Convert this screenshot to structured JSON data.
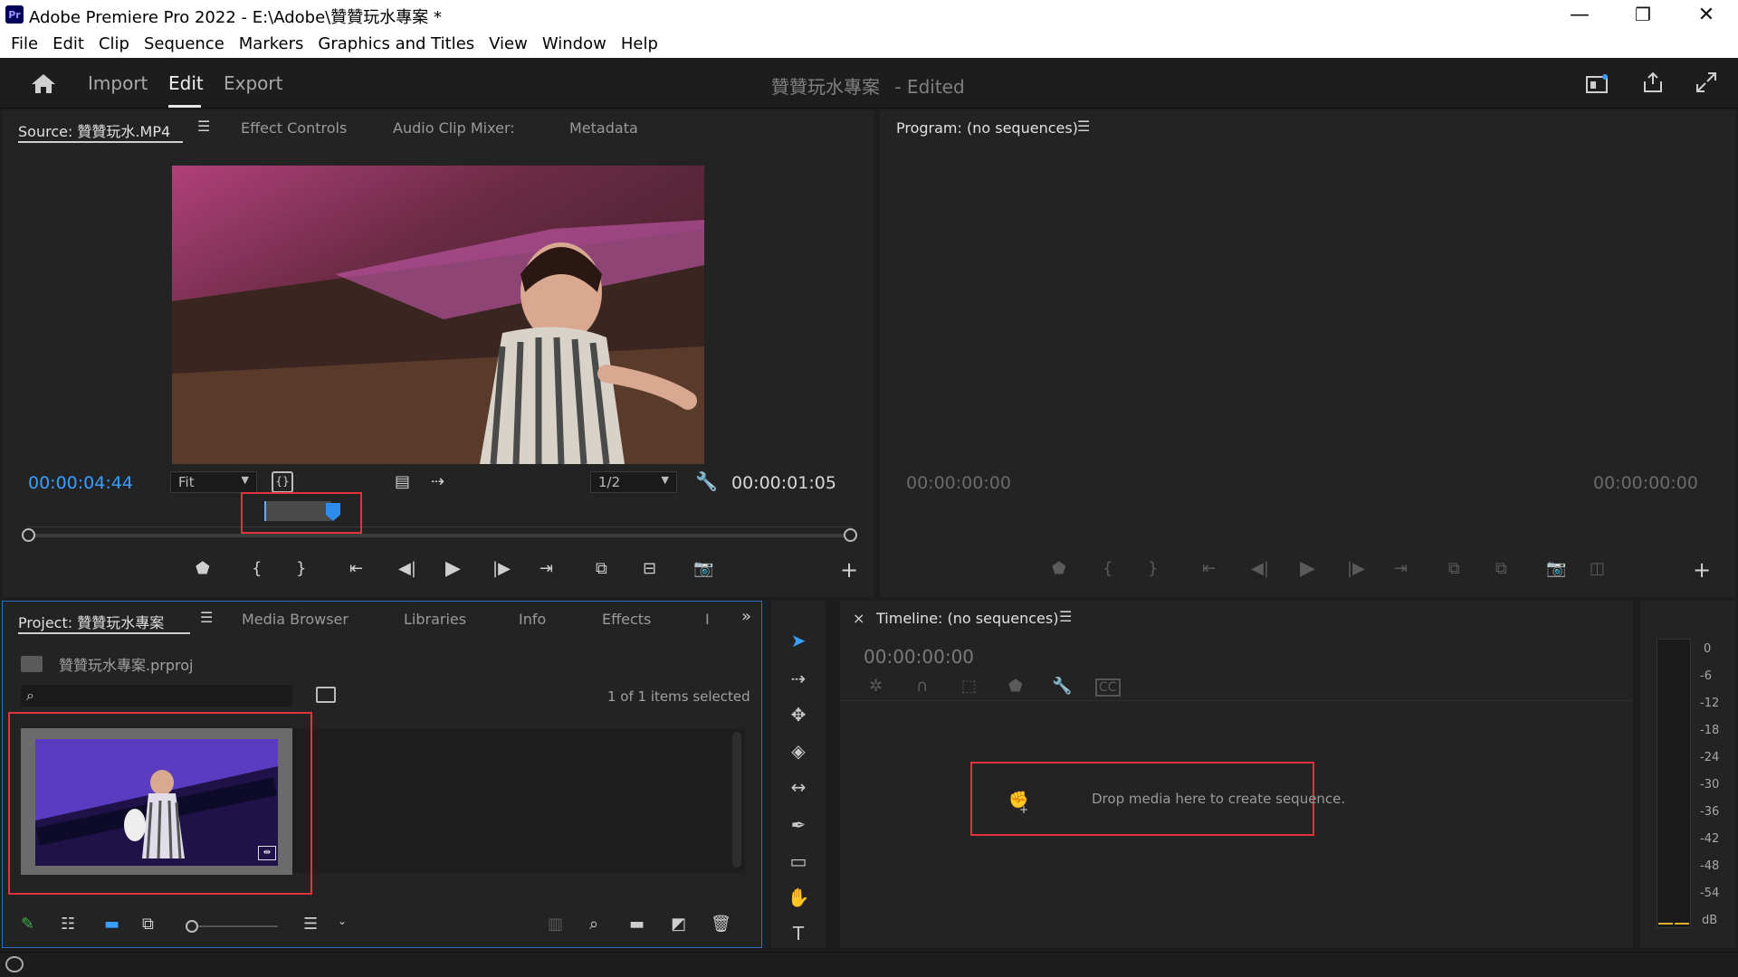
{
  "window": {
    "app_icon": "Pr",
    "title": "Adobe Premiere Pro 2022 - E:\\Adobe\\贊贊玩水專案 *",
    "minimize": "—",
    "restore": "❐",
    "close": "✕"
  },
  "menu": [
    "File",
    "Edit",
    "Clip",
    "Sequence",
    "Markers",
    "Graphics and Titles",
    "View",
    "Window",
    "Help"
  ],
  "header": {
    "nav": [
      "Import",
      "Edit",
      "Export"
    ],
    "active": "Edit",
    "project_title": "贊贊玩水專案",
    "status": "- Edited"
  },
  "source_panel": {
    "tabs": [
      "Source: 贊贊玩水.MP4",
      "Effect Controls",
      "Audio Clip Mixer:",
      "Metadata"
    ],
    "timecode_left": "00:00:04:44",
    "zoom": "Fit",
    "resolution": "1/2",
    "duration": "00:00:01:05"
  },
  "program_panel": {
    "tab": "Program: (no sequences)",
    "timecode_left": "00:00:00:00",
    "timecode_right": "00:00:00:00"
  },
  "project_panel": {
    "tabs": [
      "Project: 贊贊玩水專案",
      "Media Browser",
      "Libraries",
      "Info",
      "Effects",
      "I"
    ],
    "file": "贊贊玩水專案.prproj",
    "selection": "1 of 1 items selected",
    "search_placeholder": ""
  },
  "timeline_panel": {
    "close": "×",
    "tab": "Timeline: (no sequences)",
    "timecode": "00:00:00:00",
    "drop_hint": "Drop media here to create sequence."
  },
  "audio_meter": {
    "labels": [
      "0",
      "-6",
      "-12",
      "-18",
      "-24",
      "-30",
      "-36",
      "-42",
      "-48",
      "-54",
      "dB"
    ]
  },
  "colors": {
    "timecode_blue": "#3b9eff",
    "highlight_red": "#e0333d",
    "selection_blue": "#2d8ceb"
  }
}
